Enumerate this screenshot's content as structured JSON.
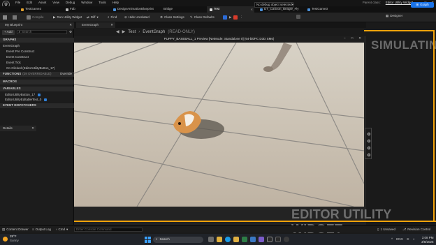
{
  "app": {
    "logo_text": "U",
    "menus": [
      "File",
      "Edit",
      "Asset",
      "View",
      "Debug",
      "Window",
      "Tools",
      "Help"
    ],
    "parent_class_label": "Parent class:",
    "parent_class_value": "Editor Utility Widget"
  },
  "tabs": [
    {
      "label": "TestGame3"
    },
    {
      "label": "Fab"
    },
    {
      "label": "DesignAnimationBlueprint"
    },
    {
      "label": "Bridge"
    },
    {
      "label": "Test"
    },
    {
      "label": "DT_Cartoon_Beagle_Fly"
    },
    {
      "label": "TestGame3"
    }
  ],
  "toolbar": {
    "compile": "Compile",
    "run": "Run Utility Widget",
    "diff": "Diff",
    "find": "Find",
    "hide_unrelated": "Hide Unrelated",
    "class_settings": "Class Settings",
    "class_defaults": "Class Defaults",
    "debug_select": "No debug object selected",
    "designer": "Designer",
    "graph": "Graph"
  },
  "left_panel": {
    "tab_label": "My Blueprint",
    "add_label": "+ Add",
    "search_placeholder": "Search",
    "graphs_header": "GRAPHS",
    "graphs": [
      "EventGraph"
    ],
    "events": [
      "Event Pre Construct",
      "Event Construct",
      "Event Tick",
      "On Clicked (EditorUtilityButton_17)"
    ],
    "functions_header": "FUNCTIONS",
    "functions_count": "(29 OVERRIDABLE)",
    "override_label": "Override",
    "macros_header": "MACROS",
    "variables_header": "VARIABLES",
    "variables": [
      "EditorUtilityButton_17",
      "EditorUtilityEditableText_0"
    ],
    "dispatchers_header": "EVENT DISPATCHERS",
    "details_tab": "Details"
  },
  "center": {
    "graph_tab": "EventGraph",
    "breadcrumb_root": "Test",
    "breadcrumb_graph": "EventGraph",
    "breadcrumb_mode": "(READ-ONLY)",
    "preview_title": "PUPPY_BASEBALL_1 Preview [NetMode: Standalone 0] (64-bit/PC D3D SM6)",
    "simulating": "SIMULATING",
    "watermark": "EDITOR UTILITY WIDGET"
  },
  "statusbar": {
    "content_drawer": "Content Drawer",
    "output_log": "Output Log",
    "cmd": "Cmd",
    "console_placeholder": "Enter Console Command",
    "unsaved": "1 Unsaved",
    "revision": "Revision Control"
  },
  "taskbar": {
    "weather_temp": "28°F",
    "weather_desc": "Sunny",
    "search_placeholder": "Search",
    "lang": "ENG",
    "time": "3:08 PM",
    "date": "3/8/2025"
  },
  "colors": {
    "accent_blue": "#1a73e8",
    "simulate_orange": "#f4a30a",
    "floor": "#cec4b6"
  }
}
